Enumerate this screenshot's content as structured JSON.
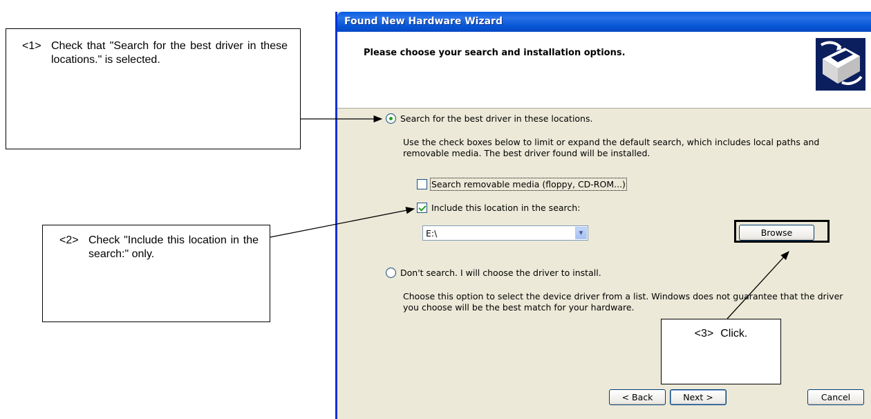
{
  "callouts": [
    {
      "num": "<1>",
      "text": "Check that \"Search for the best driver in these locations.\" is selected."
    },
    {
      "num": "<2>",
      "text": "Check \"Include this location in the search:\" only."
    },
    {
      "num": "<3>",
      "text": "Click."
    }
  ],
  "wizard": {
    "title": "Found New Hardware Wizard",
    "header": "Please choose your search and installation options.",
    "option_search": "Search for the best driver in these locations.",
    "search_desc": "Use the check boxes below to limit or expand the default search, which includes local paths and removable media. The best driver found will be installed.",
    "check_removable": "Search removable media (floppy, CD-ROM...)",
    "check_location": "Include this location in the search:",
    "location_value": "E:\\",
    "browse": "Browse",
    "option_dont_search": "Don't search. I will choose the driver to install.",
    "dont_search_desc": "Choose this option to select the device driver from a list.  Windows does not guarantee that the driver you choose will be the best match for your hardware.",
    "back": "< Back",
    "next": "Next >",
    "cancel": "Cancel"
  },
  "state": {
    "option_search_selected": true,
    "check_removable_checked": false,
    "check_location_checked": true
  }
}
